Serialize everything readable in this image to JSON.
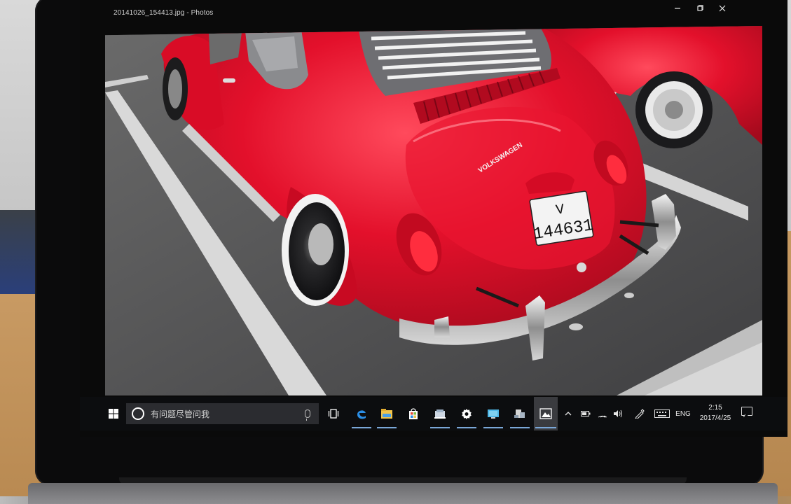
{
  "window": {
    "title": "20141026_154413.jpg - Photos",
    "minimize_icon": "minimize-icon",
    "maximize_icon": "restore-icon",
    "close_icon": "close-icon"
  },
  "photo": {
    "license_plate_line1": "V",
    "license_plate_line2": "144631",
    "badge_text": "VOLKSWAGEN"
  },
  "taskbar": {
    "search_placeholder": "有问题尽管问我",
    "apps": [
      {
        "name": "task-view-icon"
      },
      {
        "name": "edge-icon"
      },
      {
        "name": "file-explorer-icon"
      },
      {
        "name": "store-icon"
      },
      {
        "name": "app-icon"
      },
      {
        "name": "settings-icon"
      },
      {
        "name": "app-icon"
      },
      {
        "name": "app-icon"
      },
      {
        "name": "photos-icon"
      }
    ],
    "tray": {
      "language": "ENG",
      "time": "2:15",
      "date": "2017/4/25"
    }
  },
  "colors": {
    "car_red": "#e3102b",
    "accent_underline": "#7aa7d8",
    "taskbar": "#0c0d0f"
  }
}
